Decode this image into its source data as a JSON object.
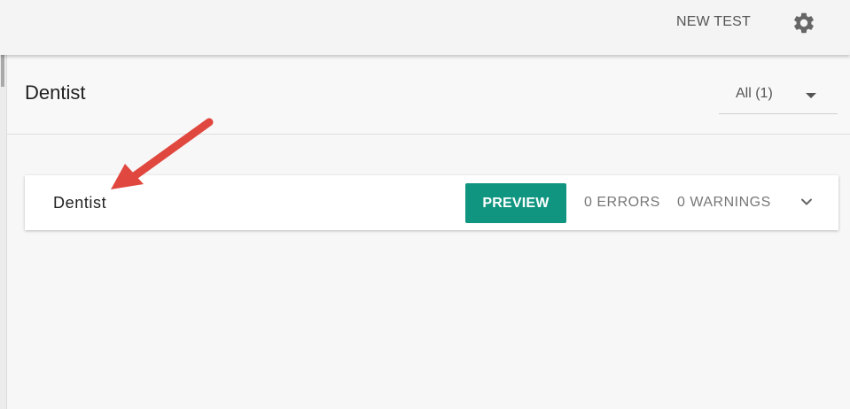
{
  "topbar": {
    "new_test_label": "NEW TEST",
    "settings_icon": "gear-icon"
  },
  "header": {
    "title": "Dentist",
    "filter": {
      "selected": "All (1)",
      "icon": "dropdown-arrow-icon"
    }
  },
  "result": {
    "name": "Dentist",
    "preview_label": "PREVIEW",
    "errors": "0 ERRORS",
    "warnings": "0 WARNINGS",
    "expand_icon": "chevron-down-icon"
  },
  "annotation": {
    "icon": "red-arrow-annotation",
    "color": "#e0483f"
  },
  "colors": {
    "accent": "#0f9580",
    "topbar_bg": "#f4f4f4",
    "page_bg": "#f7f7f7"
  }
}
